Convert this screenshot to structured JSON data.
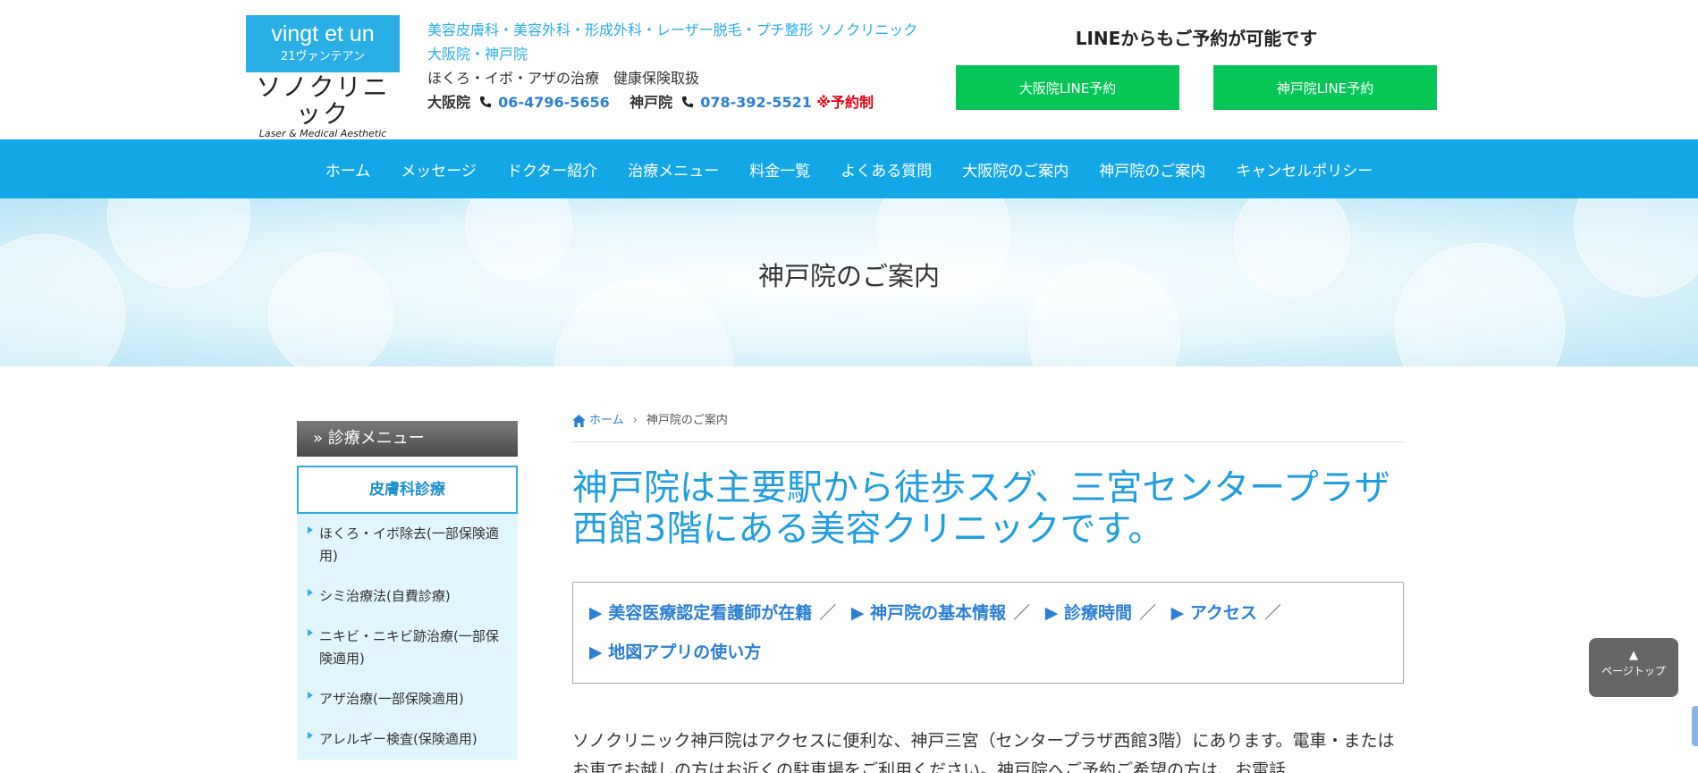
{
  "logo": {
    "line1": "vingt et un",
    "line2": "21ヴァンテアン",
    "line3": "ソノクリニック",
    "line4": "Laser & Medical Aesthetic"
  },
  "header": {
    "tagline": "美容皮膚科・美容外科・形成外科・レーザー脱毛・プチ整形 ソノクリニック",
    "branches": "大阪院・神戸院",
    "treatments": "ほくろ・イボ・アザの治療　健康保険取扱",
    "osaka_label": "大阪院",
    "osaka_phone": "06-4796-5656",
    "kobe_label": "神戸院",
    "kobe_phone": "078-392-5521",
    "reservation_note": "※予約制"
  },
  "line": {
    "title": "LINEからもご予約が可能です",
    "osaka_btn": "大阪院LINE予約",
    "kobe_btn": "神戸院LINE予約"
  },
  "nav": {
    "items": [
      "ホーム",
      "メッセージ",
      "ドクター紹介",
      "治療メニュー",
      "料金一覧",
      "よくある質問",
      "大阪院のご案内",
      "神戸院のご案内",
      "キャンセルポリシー"
    ]
  },
  "hero": {
    "title": "神戸院のご案内"
  },
  "sidebar": {
    "header": "» 診療メニュー",
    "category": "皮膚科診療",
    "items": [
      "ほくろ・イボ除去(一部保険適用)",
      "シミ治療法(自費診療)",
      "ニキビ・ニキビ跡治療(一部保険適用)",
      "アザ治療(一部保険適用)",
      "アレルギー検査(保険適用)"
    ]
  },
  "breadcrumb": {
    "home": "ホーム",
    "current": "神戸院のご案内"
  },
  "main": {
    "title": "神戸院は主要駅から徒歩スグ、三宮センタープラザ西館3階にある美容クリニックです。",
    "toc": [
      "▶ 美容医療認定看護師が在籍",
      "▶ 神戸院の基本情報",
      "▶ 診療時間",
      "▶ アクセス",
      "▶ 地図アプリの使い方"
    ],
    "toc_separator": "／",
    "intro": "ソノクリニック神戸院はアクセスに便利な、神戸三宮（センタープラザ西館3階）にあります。電車・またはお車でお越しの方はお近くの駐車場をご利用ください。神戸院へご予約ご希望の方は、お電話"
  },
  "pagetop": {
    "arrow": "▲",
    "label": "ページトップ"
  }
}
